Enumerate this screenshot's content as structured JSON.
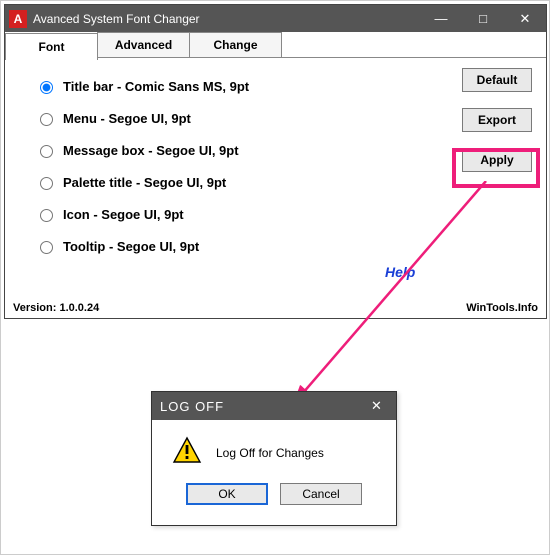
{
  "window": {
    "title": "Avanced System Font Changer",
    "icon_letter": "A",
    "minimize": "—",
    "maximize": "□",
    "close": "✕"
  },
  "tabs": [
    {
      "label": "Font"
    },
    {
      "label": "Advanced"
    },
    {
      "label": "Change"
    }
  ],
  "radios": [
    {
      "label": "Title bar - Comic Sans MS, 9pt",
      "selected": true
    },
    {
      "label": "Menu - Segoe UI, 9pt",
      "selected": false
    },
    {
      "label": "Message box - Segoe UI, 9pt",
      "selected": false
    },
    {
      "label": "Palette title - Segoe UI, 9pt",
      "selected": false
    },
    {
      "label": "Icon - Segoe UI, 9pt",
      "selected": false
    },
    {
      "label": "Tooltip - Segoe UI, 9pt",
      "selected": false
    }
  ],
  "buttons": {
    "default": "Default",
    "export": "Export",
    "apply": "Apply"
  },
  "help": "Help",
  "footer": {
    "version": "Version: 1.0.0.24",
    "site": "WinTools.Info"
  },
  "dialog": {
    "title": "LOG OFF",
    "close": "✕",
    "message": "Log Off for Changes",
    "ok": "OK",
    "cancel": "Cancel"
  }
}
